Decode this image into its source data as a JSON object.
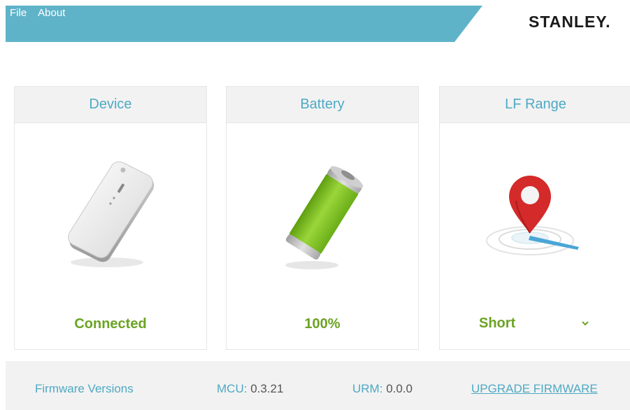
{
  "menu": {
    "file": "File",
    "about": "About"
  },
  "brand": {
    "logo": "STANLEY."
  },
  "cards": {
    "device": {
      "title": "Device",
      "status": "Connected",
      "icon": "device-tag-icon"
    },
    "battery": {
      "title": "Battery",
      "status": "100%",
      "level": 1.0,
      "icon": "battery-icon"
    },
    "range": {
      "title": "LF Range",
      "value": "Short",
      "icon": "location-pin-icon"
    }
  },
  "footer": {
    "firmware_label": "Firmware Versions",
    "mcu_label": "MCU:",
    "mcu_value": "0.3.21",
    "urm_label": "URM:",
    "urm_value": "0.0.0",
    "upgrade": "UPGRADE FIRMWARE"
  },
  "colors": {
    "accent": "#5fb3c9",
    "title_blue": "#4fa9c4",
    "status_green": "#6ba323",
    "panel_gray": "#f2f2f2"
  }
}
